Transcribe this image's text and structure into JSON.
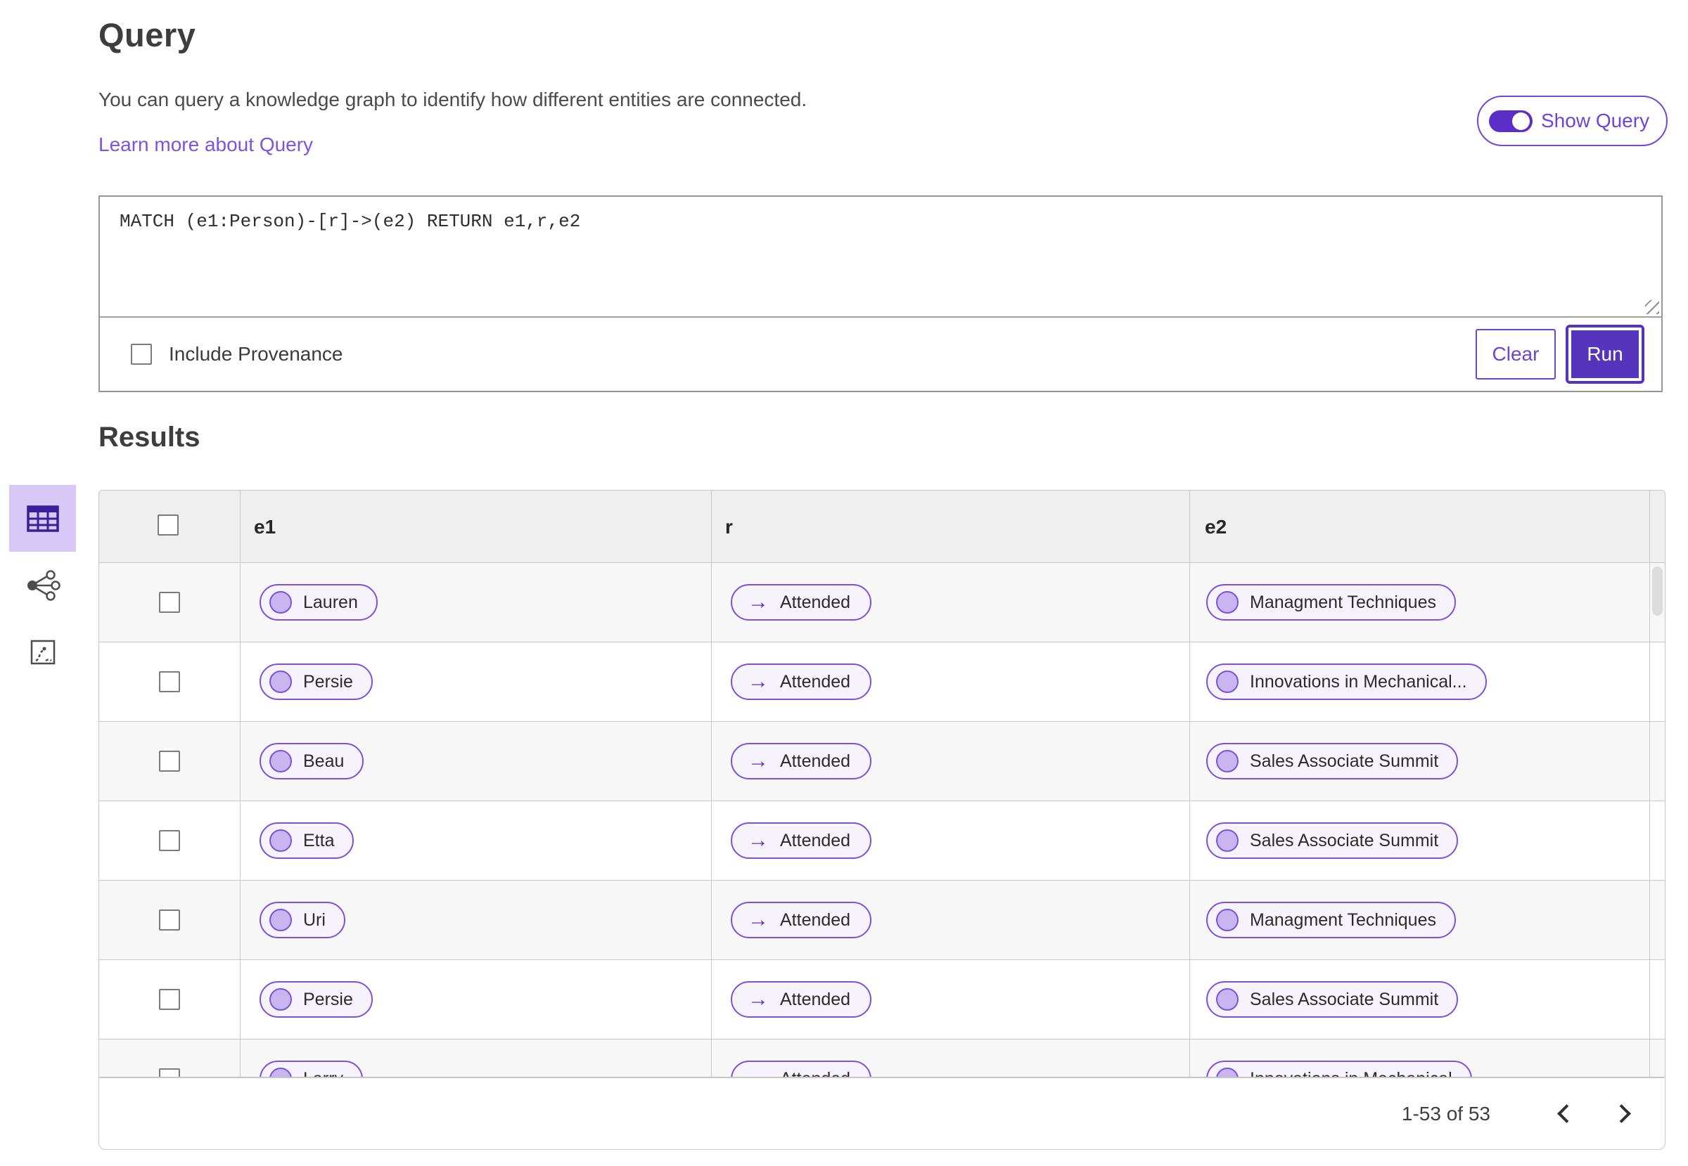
{
  "query": {
    "title": "Query",
    "description": "You can query a knowledge graph to identify how different entities are connected.",
    "learn_more": "Learn more about Query",
    "show_query_label": "Show Query",
    "show_query_on": true,
    "query_text": "MATCH (e1:Person)-[r]->(e2) RETURN e1,r,e2",
    "include_provenance_label": "Include Provenance",
    "include_provenance_checked": false,
    "clear_label": "Clear",
    "run_label": "Run"
  },
  "results": {
    "title": "Results",
    "view_switcher": [
      "table-view",
      "graph-view",
      "fit-view"
    ],
    "selected_view": "table-view",
    "columns": [
      "e1",
      "r",
      "e2"
    ],
    "rows": [
      {
        "e1": "Lauren",
        "r": "Attended",
        "e2": "Managment Techniques"
      },
      {
        "e1": "Persie",
        "r": "Attended",
        "e2": "Innovations in Mechanical..."
      },
      {
        "e1": "Beau",
        "r": "Attended",
        "e2": "Sales Associate Summit"
      },
      {
        "e1": "Etta",
        "r": "Attended",
        "e2": "Sales Associate Summit"
      },
      {
        "e1": "Uri",
        "r": "Attended",
        "e2": "Managment Techniques"
      },
      {
        "e1": "Persie",
        "r": "Attended",
        "e2": "Sales Associate Summit"
      },
      {
        "e1": "Larry",
        "r": "Attended",
        "e2": "Innovations in Mechanical"
      }
    ],
    "pagination": {
      "range_label": "1-53 of 53",
      "prev_icon": "chevron-left",
      "next_icon": "chevron-right"
    }
  },
  "icons": {
    "arrow_right": "→"
  },
  "colors": {
    "accent_purple": "#6f42d8",
    "run_button_bg": "#5635bd",
    "toggle_track": "#5b2ec8",
    "selected_view_bg": "#d7c8f8",
    "pill_border": "#7a52dd",
    "pill_bg": "#f6f3fd",
    "pill_node_fill": "#c9b6f0",
    "table_header_bg": "#efefef",
    "row_alt_bg": "#f7f7f7",
    "border_gray": "#c9c9c9",
    "link_purple": "#7a54e0"
  }
}
